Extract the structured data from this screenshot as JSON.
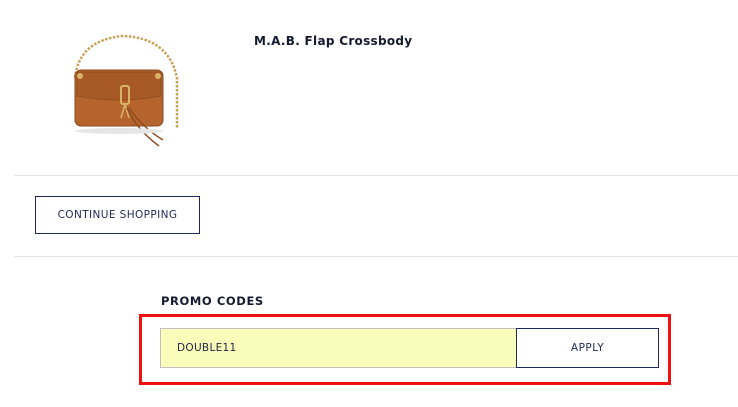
{
  "cart_item": {
    "product_name": "M.A.B. Flap Crossbody",
    "image_icon": "crossbody-bag-image",
    "bag_color": "#b4642c"
  },
  "actions": {
    "continue_shopping_label": "CONTINUE SHOPPING"
  },
  "promo": {
    "title": "PROMO CODES",
    "input_value": "DOUBLE11",
    "apply_label": "APPLY",
    "highlight_color": "#ee1111",
    "input_background": "#fafdba"
  }
}
